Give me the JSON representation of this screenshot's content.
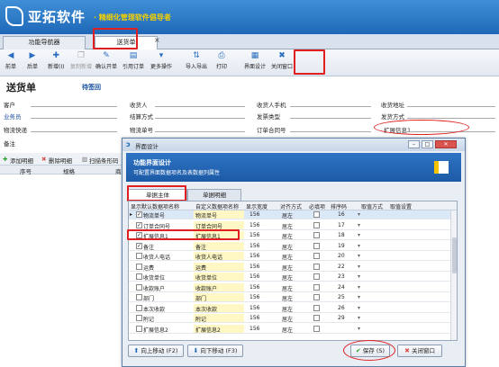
{
  "app": {
    "name": "亚拓软件",
    "slogan": "· 精细化管理软件倡导者"
  },
  "tabs": [
    {
      "label": "功能导航器"
    },
    {
      "label": "送货单"
    }
  ],
  "tab_close": "×",
  "toolbar": [
    {
      "label": "前单",
      "icon": "◀",
      "disabled": false
    },
    {
      "label": "后单",
      "icon": "▶",
      "disabled": false
    },
    {
      "label": "新增(I)",
      "icon": "✚",
      "disabled": false
    },
    {
      "label": "复制新增",
      "icon": "❐",
      "disabled": true
    },
    {
      "label": "确认开单",
      "icon": "✎",
      "disabled": false
    },
    {
      "label": "引用订单",
      "icon": "▤",
      "disabled": false
    },
    {
      "label": "更多操作",
      "icon": "▾",
      "disabled": false
    },
    {
      "label": "导入导出",
      "icon": "⇅",
      "disabled": false
    },
    {
      "label": "打印",
      "icon": "⎙",
      "disabled": false
    },
    {
      "label": "界面设计",
      "icon": "▦",
      "disabled": false
    },
    {
      "label": "关闭窗口",
      "icon": "✖",
      "disabled": false
    }
  ],
  "doc": {
    "title": "送货单",
    "status": "待签回"
  },
  "fields": {
    "customer": "客户",
    "salesman": "业务员",
    "express": "物流快递",
    "remark": "备注",
    "receiver": "收货人",
    "settle": "结算方式",
    "logistics_no": "物流单号",
    "receiver_phone": "收货人手机",
    "invoice_type": "发票类型",
    "contract_no": "订单合同号",
    "address": "收货地址",
    "ship_method": "发货方式",
    "ext1": "扩展信息1"
  },
  "grid": {
    "tools": [
      "添加明细",
      "删除明细",
      "扫描条形码"
    ],
    "cols": [
      "序号",
      "规格",
      "商"
    ]
  },
  "dialog": {
    "title": "界面设计",
    "banner_title": "功能界面设计",
    "banner_sub": "可配置界面数据项名及表数据列属性",
    "tabs": [
      "单据主体",
      "单据明细"
    ],
    "headers": [
      "显示",
      "默认数据项名称",
      "自定义数据项名称",
      "显示宽度",
      "对齐方式",
      "必填项",
      "排序码",
      "取值方式",
      "取值设置"
    ],
    "rows": [
      {
        "show": true,
        "def": "物流单号",
        "custom": "物流单号",
        "width": "156",
        "align": "居左",
        "req": false,
        "order": "16",
        "sel": true
      },
      {
        "show": true,
        "def": "订单合同号",
        "custom": "订单合同号",
        "width": "156",
        "align": "居左",
        "req": false,
        "order": "17",
        "sel": false
      },
      {
        "show": true,
        "def": "扩展信息1",
        "custom": "扩展信息1",
        "width": "156",
        "align": "居左",
        "req": false,
        "order": "18",
        "sel": false
      },
      {
        "show": true,
        "def": "备注",
        "custom": "备注",
        "width": "156",
        "align": "居左",
        "req": false,
        "order": "19",
        "sel": false
      },
      {
        "show": false,
        "def": "收货人电话",
        "custom": "收货人电话",
        "width": "156",
        "align": "居左",
        "req": false,
        "order": "20",
        "sel": false
      },
      {
        "show": false,
        "def": "运费",
        "custom": "运费",
        "width": "156",
        "align": "居左",
        "req": false,
        "order": "22",
        "sel": false
      },
      {
        "show": false,
        "def": "收货单位",
        "custom": "收货单位",
        "width": "156",
        "align": "居左",
        "req": false,
        "order": "23",
        "sel": false
      },
      {
        "show": false,
        "def": "收款账户",
        "custom": "收款账户",
        "width": "156",
        "align": "居左",
        "req": false,
        "order": "24",
        "sel": false
      },
      {
        "show": false,
        "def": "部门",
        "custom": "部门",
        "width": "156",
        "align": "居左",
        "req": false,
        "order": "25",
        "sel": false
      },
      {
        "show": false,
        "def": "本次收款",
        "custom": "本次收款",
        "width": "156",
        "align": "居左",
        "req": false,
        "order": "26",
        "sel": false
      },
      {
        "show": false,
        "def": "附记",
        "custom": "附记",
        "width": "156",
        "align": "居左",
        "req": false,
        "order": "29",
        "sel": false
      },
      {
        "show": false,
        "def": "扩展信息2",
        "custom": "扩展信息2",
        "width": "156",
        "align": "居左",
        "req": false,
        "order": "",
        "sel": false
      }
    ],
    "buttons": {
      "up": "向上移动 (F2)",
      "down": "向下移动 (F3)",
      "save": "保存 (S)",
      "close": "关闭窗口"
    }
  },
  "colors": {
    "banner": "#2a7ccf",
    "slogan": "#f5d000",
    "highlight": "#e02020"
  }
}
